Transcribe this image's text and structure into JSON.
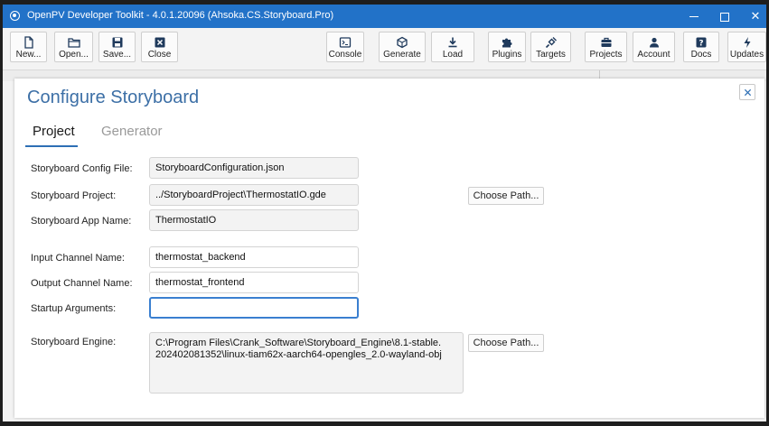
{
  "window": {
    "title": "OpenPV Developer Toolkit - 4.0.1.20096 (Ahsoka.CS.Storyboard.Pro)"
  },
  "toolbar": {
    "new": "New...",
    "open": "Open...",
    "save": "Save...",
    "close": "Close",
    "console": "Console",
    "generate": "Generate",
    "load": "Load",
    "plugins": "Plugins",
    "targets": "Targets",
    "projects": "Projects",
    "account": "Account",
    "docs": "Docs",
    "updates": "Updates"
  },
  "dialog": {
    "title": "Configure Storyboard",
    "tabs": [
      "Project",
      "Generator"
    ],
    "fields": {
      "config_file_label": "Storyboard Config File:",
      "config_file_value": "StoryboardConfiguration.json",
      "project_label": "Storyboard Project:",
      "project_value": "../StoryboardProject\\ThermostatIO.gde",
      "app_name_label": "Storyboard App Name:",
      "app_name_value": "ThermostatIO",
      "input_channel_label": "Input Channel Name:",
      "input_channel_value": "thermostat_backend",
      "output_channel_label": "Output Channel Name:",
      "output_channel_value": "thermostat_frontend",
      "startup_args_label": "Startup Arguments:",
      "startup_args_value": "",
      "engine_label": "Storyboard Engine:",
      "engine_value": "C:\\Program Files\\Crank_Software\\Storyboard_Engine\\8.1-stable.\n202402081352\\linux-tiam62x-aarch64-opengles_2.0-wayland-obj"
    },
    "choose_path_label": "Choose Path..."
  },
  "colors": {
    "titlebar": "#2272c8",
    "dialog_title": "#3c6fa6",
    "accent": "#2d6fb5"
  }
}
